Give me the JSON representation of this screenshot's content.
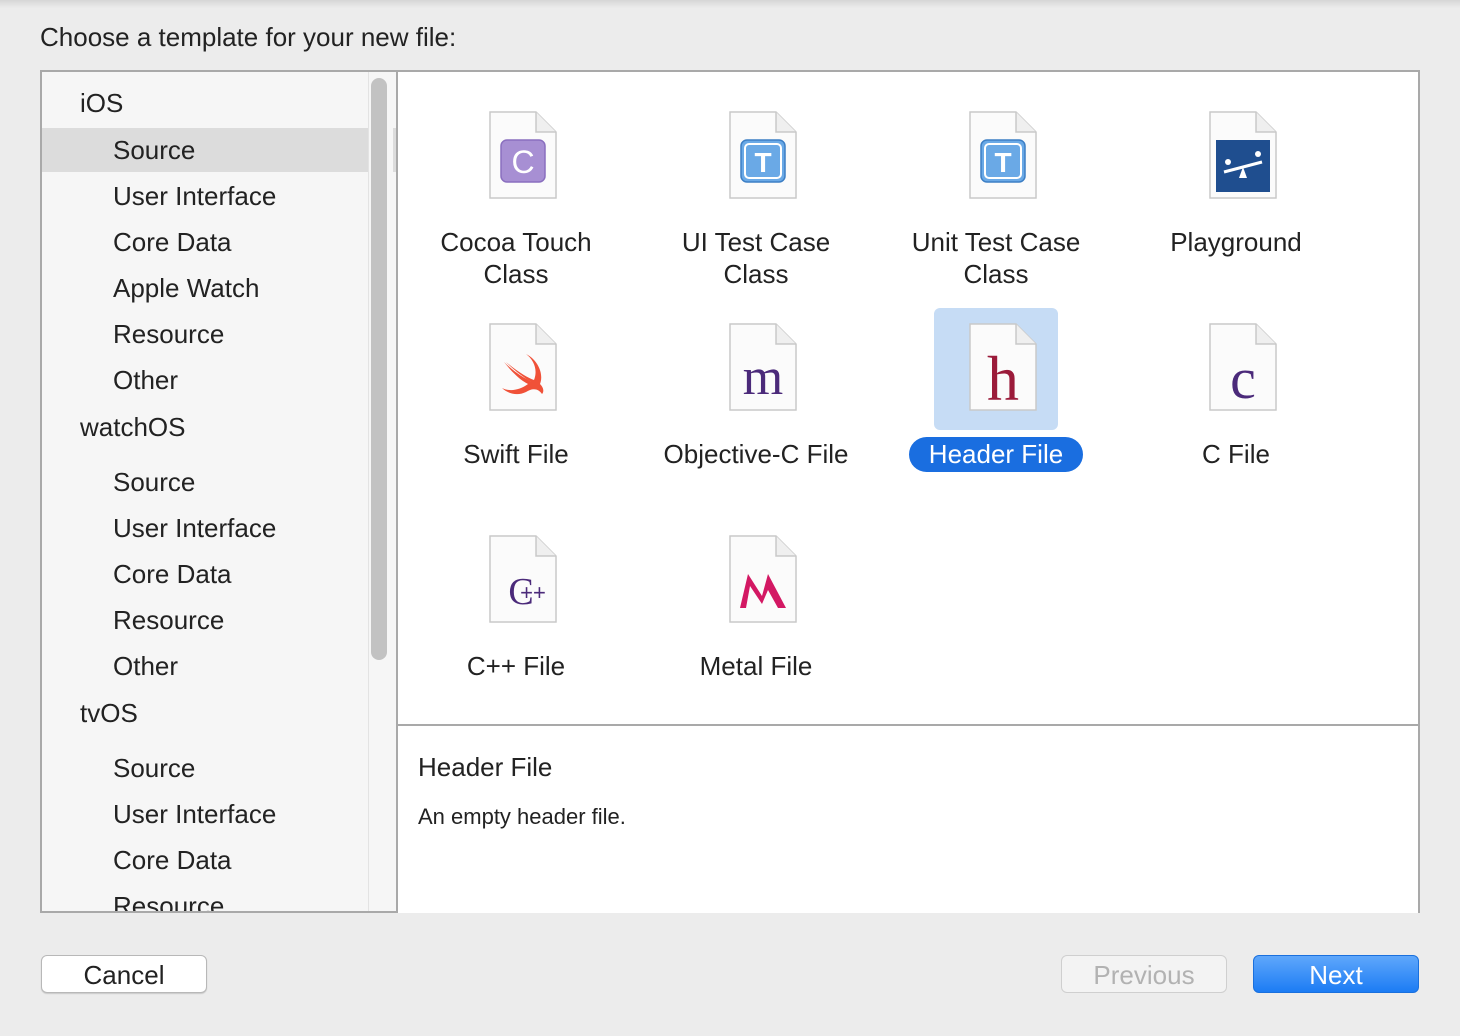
{
  "dialog": {
    "prompt": "Choose a template for your new file:"
  },
  "sidebar": {
    "groups": [
      {
        "title": "iOS",
        "items": [
          "Source",
          "User Interface",
          "Core Data",
          "Apple Watch",
          "Resource",
          "Other"
        ]
      },
      {
        "title": "watchOS",
        "items": [
          "Source",
          "User Interface",
          "Core Data",
          "Resource",
          "Other"
        ]
      },
      {
        "title": "tvOS",
        "items": [
          "Source",
          "User Interface",
          "Core Data",
          "Resource"
        ]
      }
    ],
    "selected": "iOS / Source"
  },
  "templates": [
    {
      "label": "Cocoa Touch\nClass",
      "icon": "cocoa-touch-class-icon",
      "glyph": "C"
    },
    {
      "label": "UI Test Case\nClass",
      "icon": "ui-test-case-icon",
      "glyph": "T"
    },
    {
      "label": "Unit Test Case\nClass",
      "icon": "unit-test-case-icon",
      "glyph": "T"
    },
    {
      "label": "Playground",
      "icon": "playground-icon",
      "glyph": ""
    },
    {
      "label": "Swift File",
      "icon": "swift-file-icon",
      "glyph": ""
    },
    {
      "label": "Objective-C File",
      "icon": "objective-c-file-icon",
      "glyph": "m"
    },
    {
      "label": "Header File",
      "icon": "header-file-icon",
      "glyph": "h",
      "selected": true
    },
    {
      "label": "C File",
      "icon": "c-file-icon",
      "glyph": "c"
    },
    {
      "label": "C++ File",
      "icon": "cpp-file-icon",
      "glyph": "C++"
    },
    {
      "label": "Metal File",
      "icon": "metal-file-icon",
      "glyph": ""
    }
  ],
  "description": {
    "title": "Header File",
    "text": "An empty header file."
  },
  "buttons": {
    "cancel": "Cancel",
    "previous": "Previous",
    "next": "Next"
  },
  "colors": {
    "accent": "#1a6ee0",
    "selection_highlight": "#c6dcf5",
    "sidebar_selected": "#dcdcdc"
  }
}
